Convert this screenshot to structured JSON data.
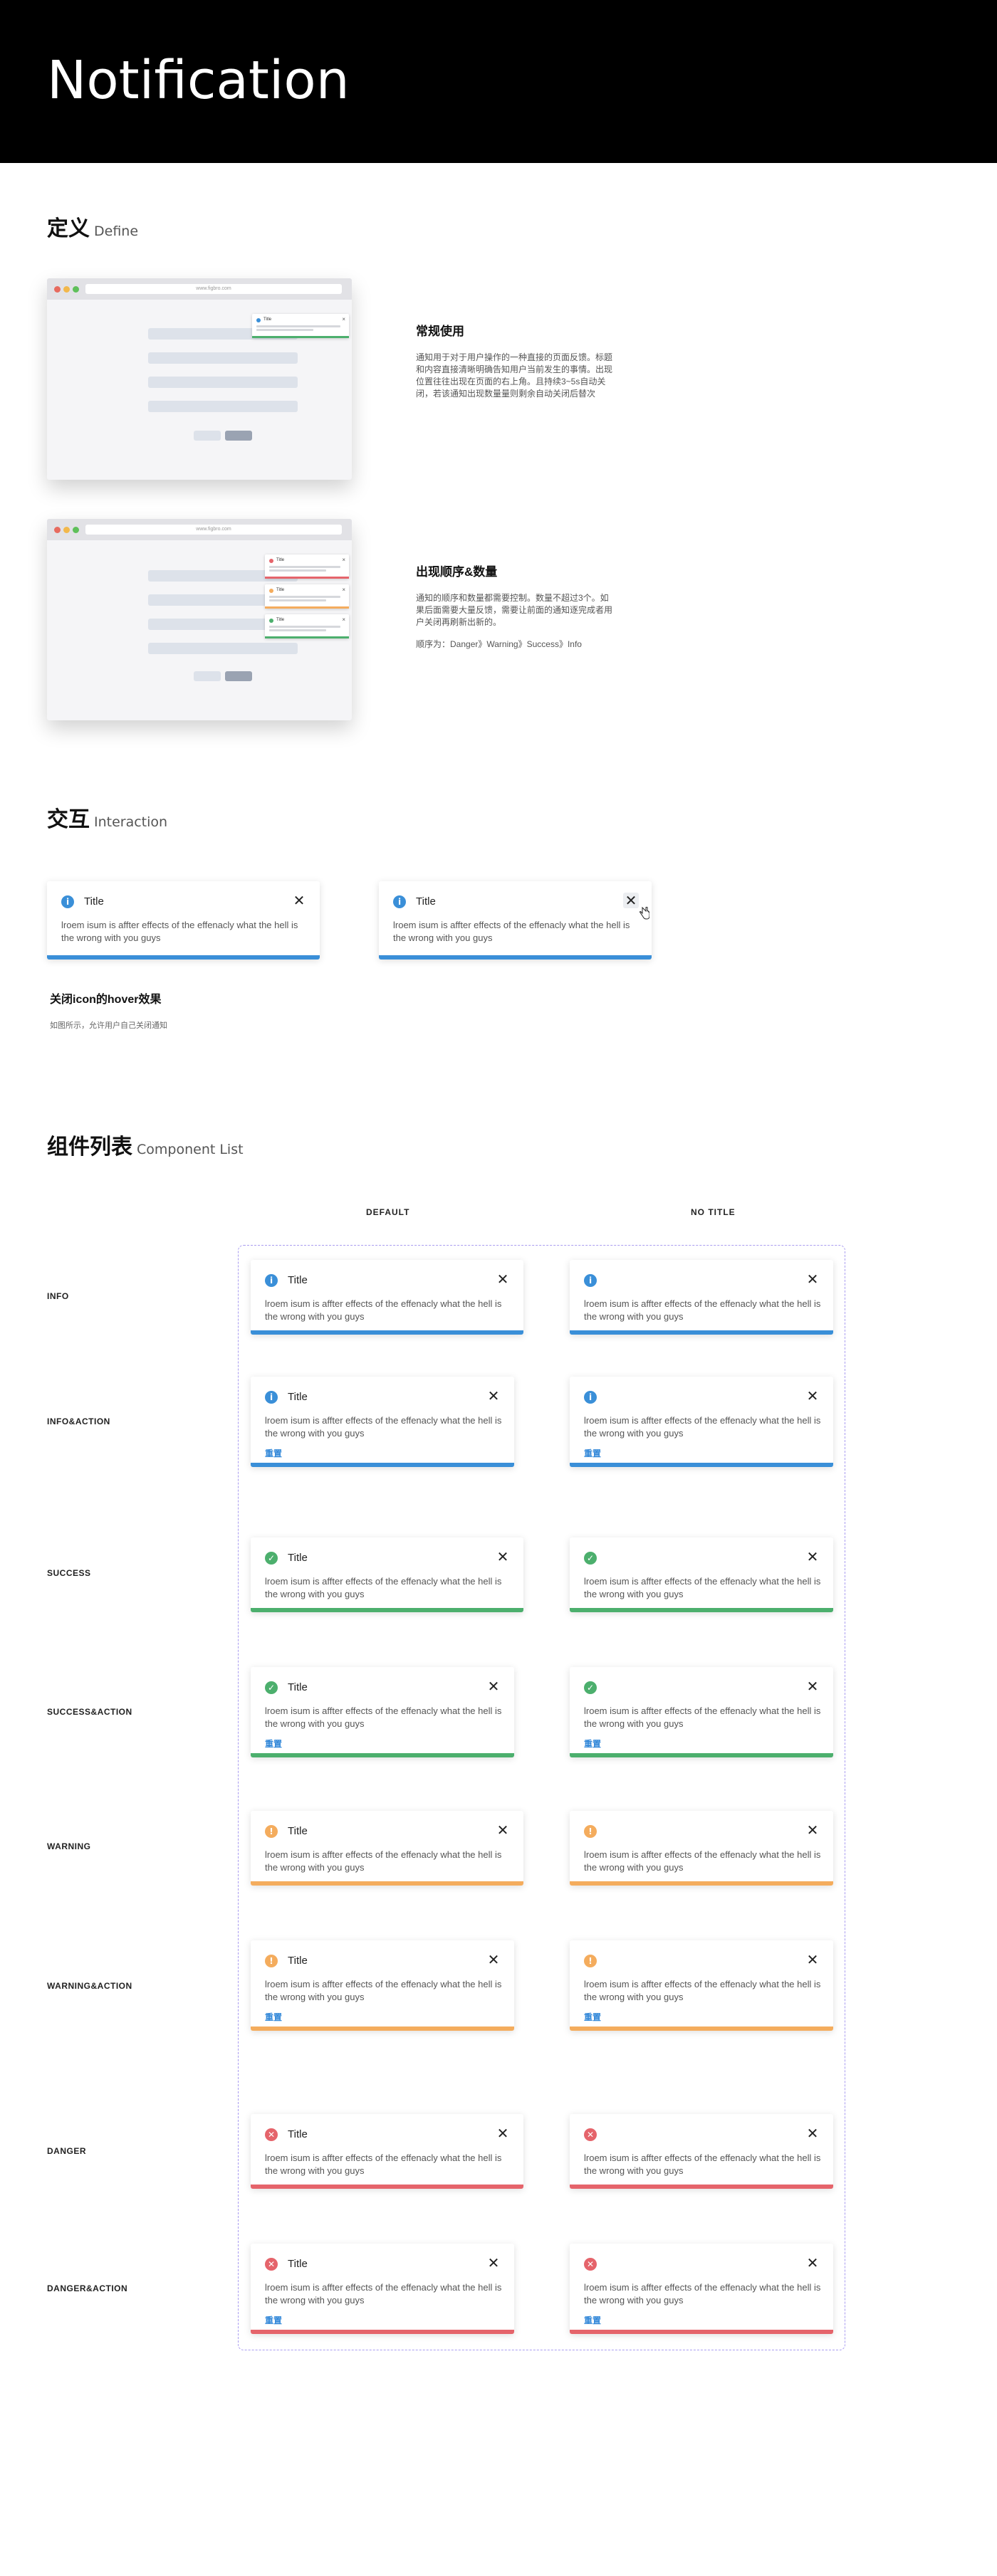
{
  "header": {
    "title": "Notification"
  },
  "define": {
    "title_zh": "定义",
    "title_en": "Define",
    "browser_url": "www.figbro.com",
    "mini_title": "Title",
    "regular": {
      "heading": "常规使用",
      "text": "通知用于对于用户操作的一种直接的页面反馈。标题和内容直接清晰明确告知用户当前发生的事情。出现位置往往出现在页面的右上角。且持续3~5s自动关闭，若该通知出现数量量则剩余自动关闭后替次"
    },
    "order": {
      "heading": "出现顺序&数量",
      "text": "通知的顺序和数量都需要控制。数量不超过3个。如果后面需要大量反馈，需要让前面的通知逐完成者用户关闭再刷新出新的。",
      "order_text": "顺序为：Danger》Warning》Success》Info"
    }
  },
  "interaction": {
    "title_zh": "交互",
    "title_en": "Interaction",
    "hover_heading": "关闭icon的hover效果",
    "hover_desc": "如图所示，允许用户自己关闭通知"
  },
  "components": {
    "title_zh": "组件列表",
    "title_en": "Component List",
    "col_default": "DEFAULT",
    "col_notitle": "NO TITLE",
    "rows": [
      "INFO",
      "INFO&ACTION",
      "SUCCESS",
      "SUCCESS&ACTION",
      "WARNING",
      "WARNING&ACTION",
      "DANGER",
      "DANGER&ACTION"
    ]
  },
  "card": {
    "title": "Title",
    "body": "lroem isum is affter effects of the effenacly what the hell is the wrong with you guys",
    "action": "重置",
    "close_glyph": "✕"
  },
  "colors": {
    "info": "#3a8fd8",
    "success": "#4caf6d",
    "warning": "#f4ac5d",
    "danger": "#e5646b"
  },
  "icons": {
    "info": "i",
    "success": "✓",
    "warning": "!",
    "danger": "✕"
  }
}
